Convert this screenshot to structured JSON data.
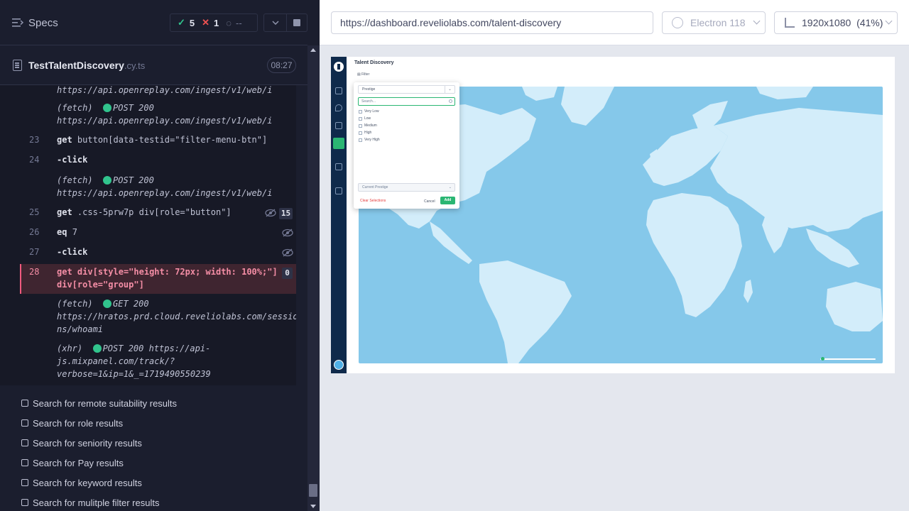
{
  "reporter": {
    "title": "Specs",
    "stats": {
      "passed": "5",
      "failed": "1",
      "pending": "--"
    },
    "spec": {
      "name": "TestTalentDiscovery",
      "ext": ".cy.ts",
      "duration": "08:27"
    },
    "log": {
      "top_url": "https://api.openreplay.com/ingest/v1/web/i",
      "fetch1_label": "(fetch)",
      "fetch1_status": "POST 200",
      "fetch1_url": "https://api.openreplay.com/ingest/v1/web/i",
      "l23_num": "23",
      "l23_cmd": "get",
      "l23_arg": "button[data-testid=\"filter-menu-btn\"]",
      "l24_num": "24",
      "l24_cmd": "-click",
      "fetch2_label": "(fetch)",
      "fetch2_status": "POST 200",
      "fetch2_url": "https://api.openreplay.com/ingest/v1/web/i",
      "l25_num": "25",
      "l25_cmd": "get",
      "l25_arg": ".css-5prw7p div[role=\"button\"]",
      "l25_count": "15",
      "l26_num": "26",
      "l26_cmd": "eq",
      "l26_arg": "7",
      "l27_num": "27",
      "l27_cmd": "-click",
      "l28_num": "28",
      "l28_cmd": "get",
      "l28_arg1": "div[style=\"height: 72px; width: 100%;\"]",
      "l28_arg2": "div[role=\"group\"]",
      "l28_count": "0",
      "fetch3_label": "(fetch)",
      "fetch3_status": "GET 200",
      "fetch3_url1": "https://hratos.prd.cloud.reveliolabs.com/sessio",
      "fetch3_url2": "ns/whoami",
      "xhr_label": "(xhr)",
      "xhr_status": "POST 200 https://api-",
      "xhr_url2": "js.mixpanel.com/track/?",
      "xhr_url3": "verbose=1&ip=1&_=1719490550239"
    },
    "tests": [
      "Search for remote suitability results",
      "Search for role results",
      "Search for seniority results",
      "Search for Pay results",
      "Search for keyword results",
      "Search for mulitple filter results"
    ]
  },
  "aut": {
    "url": "https://dashboard.reveliolabs.com/talent-discovery",
    "browser": "Electron 118",
    "viewport": "1920x1080  (41%)",
    "app": {
      "title": "Talent Discovery",
      "filter_label": "Filter",
      "filter_menu": {
        "select_value": "Prestige",
        "search_placeholder": "Search...",
        "options": [
          "Very Low",
          "Low",
          "Medium",
          "High",
          "Very High"
        ],
        "current_label": "Current Prestige",
        "clear_label": "Clear Selections",
        "cancel_label": "Cancel",
        "add_label": "Add"
      }
    }
  },
  "colors": {
    "passed": "#31c48d",
    "failed": "#f05252",
    "accent_green": "#2ab673",
    "map_water": "#85c8ea",
    "map_land": "#d3edfa"
  }
}
